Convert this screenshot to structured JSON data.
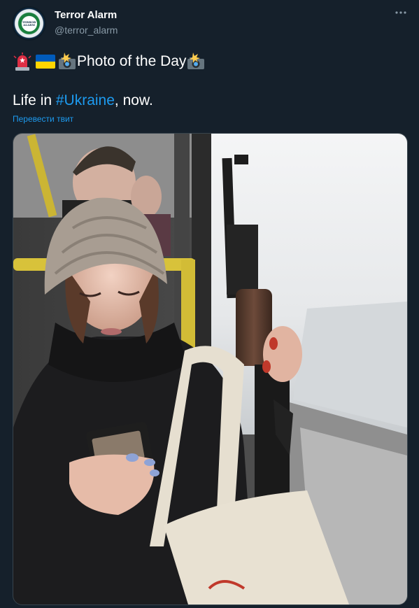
{
  "author": {
    "name": "Terror Alarm",
    "handle": "@terror_alarm",
    "avatar_text": [
      "TERROR",
      "ALARM"
    ]
  },
  "headline": {
    "emojis": [
      "police-light-icon",
      "ukraine-flag-icon",
      "camera-flash-icon",
      "camera-flash-icon"
    ],
    "text": "Photo of the Day"
  },
  "body": {
    "prefix": "Life in ",
    "hashtag": "#Ukraine",
    "suffix": ", now."
  },
  "translate_label": "Перевести твит",
  "colors": {
    "background": "#15202b",
    "link": "#1d9bf0",
    "secondary_text": "#8899a6"
  }
}
